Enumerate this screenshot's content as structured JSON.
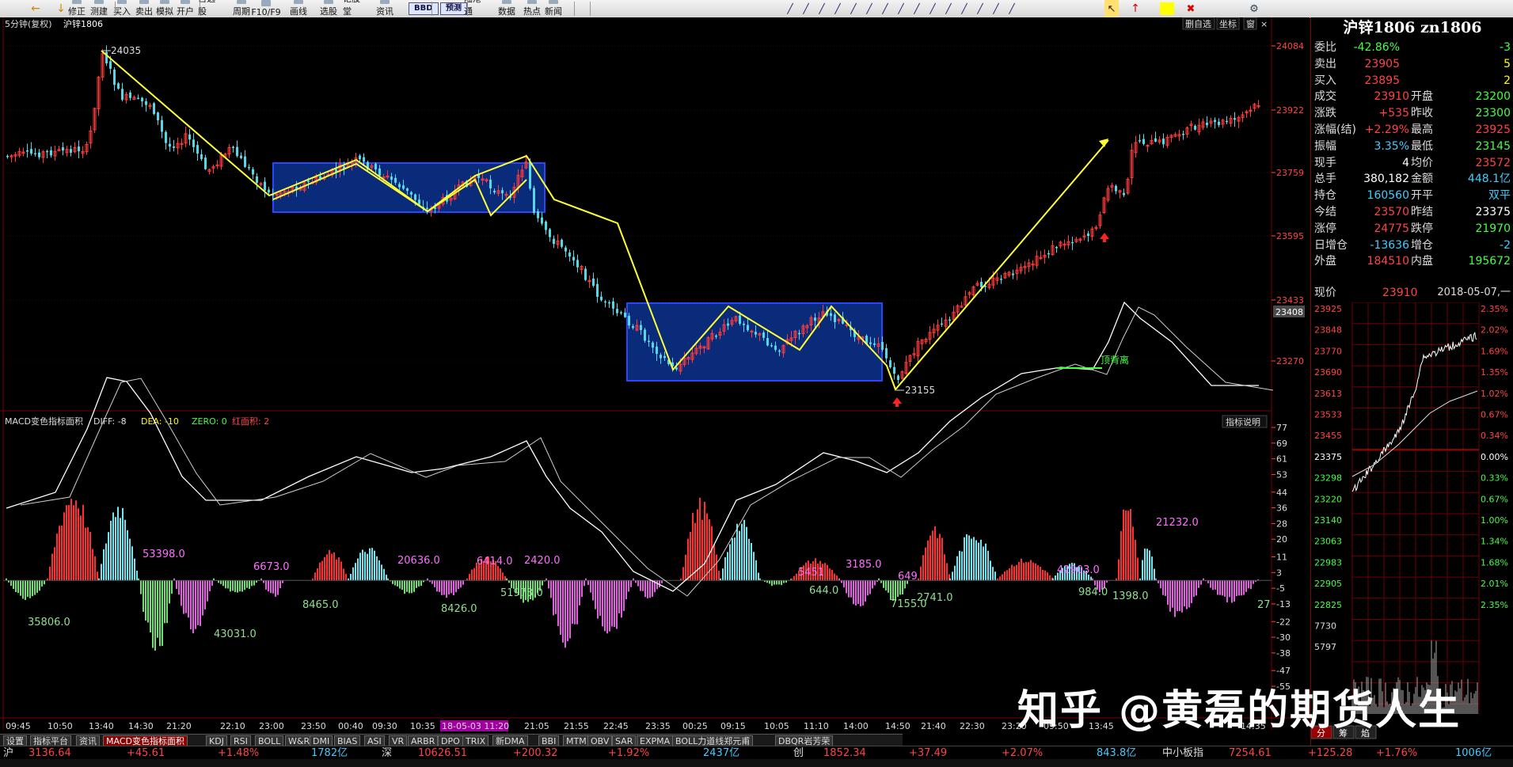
{
  "toolbar": {
    "items": [
      "修正",
      "测建",
      "买入",
      "卖出",
      "模拟",
      "开户",
      "自选股",
      "周期",
      "F10/F9",
      "画线",
      "选股",
      "论股堂",
      "资讯",
      "BBD",
      "预测",
      "陆港通",
      "数据",
      "热点",
      "新闻"
    ]
  },
  "chart": {
    "header": {
      "period": "5分钟(复权)",
      "symbol": "沪锌1806"
    },
    "top_right_buttons": [
      "删自选",
      "坐标",
      "窗"
    ],
    "peak_label": "24035",
    "low_label": "23155",
    "price_axis": [
      "24084",
      "23922",
      "23759",
      "23595",
      "23433",
      "23408",
      "23270"
    ],
    "price_marker": "23408",
    "colors": {
      "up": "#ff3b3b",
      "down": "#54d8e8",
      "line": "#ffff33",
      "box_fill": "#0a2a7a",
      "box_border": "#2848ff",
      "grid": "#7a0000",
      "axis_text": "#ff4444"
    }
  },
  "macd": {
    "title": "MACD变色指标面积",
    "diff_label": "DIFF: -8",
    "dea_label": "DEA: -10",
    "zero_label": "ZERO: 0",
    "red_label": "红面积: 2",
    "help_button": "指标说明",
    "axis": [
      "77",
      "69",
      "61",
      "53",
      "44",
      "36",
      "28",
      "20",
      "11",
      "3",
      "-5",
      "-13",
      "-22",
      "-30",
      "-38",
      "-47",
      "-55"
    ],
    "area_labels": [
      {
        "t": "35806.0",
        "c": "#8fe08f"
      },
      {
        "t": "53398.0",
        "c": "#ff70ff"
      },
      {
        "t": "43031.0",
        "c": "#8fe08f"
      },
      {
        "t": "6673.0",
        "c": "#ff70ff"
      },
      {
        "t": "8465.0",
        "c": "#8fe08f"
      },
      {
        "t": "20636.0",
        "c": "#ff70ff"
      },
      {
        "t": "8426.0",
        "c": "#8fe08f"
      },
      {
        "t": "6414.0",
        "c": "#ff70ff"
      },
      {
        "t": "2420.0",
        "c": "#ff70ff"
      },
      {
        "t": "51973.0",
        "c": "#8fe08f"
      },
      {
        "t": "5451",
        "c": "#ff70ff"
      },
      {
        "t": "644.0",
        "c": "#8fe08f"
      },
      {
        "t": "3185.0",
        "c": "#ff70ff"
      },
      {
        "t": "7155.0",
        "c": "#8fe08f"
      },
      {
        "t": "649",
        "c": "#ff70ff"
      },
      {
        "t": "2741.0",
        "c": "#8fe08f"
      },
      {
        "t": "42903.0",
        "c": "#ff70ff"
      },
      {
        "t": "984.0",
        "c": "#8fe08f"
      },
      {
        "t": "1398.0",
        "c": "#8fe08f"
      },
      {
        "t": "21232.0",
        "c": "#ff70ff"
      },
      {
        "t": "27",
        "c": "#8fe08f"
      }
    ],
    "divergence_label": "顶背离"
  },
  "time_axis": [
    "09:45",
    "10:50",
    "13:40",
    "14:30",
    "21:20",
    "22:10",
    "23:00",
    "23:50",
    "00:40",
    "09:30",
    "10:35",
    "18-05-03 11:20",
    "21:05",
    "21:55",
    "22:45",
    "23:35",
    "00:25",
    "09:15",
    "10:05",
    "11:10",
    "14:00",
    "14:50",
    "21:40",
    "22:30",
    "23:20",
    "09:50",
    "13:45",
    "14:35"
  ],
  "tabs": [
    "设置",
    "指标平台",
    "资讯",
    "MACD变色指标面积",
    "KDJ",
    "RSI",
    "BOLL",
    "W&R",
    "DMI",
    "BIAS",
    "ASI",
    "VR",
    "ARBR",
    "DPO",
    "TRIX",
    "新DMA",
    "BBI",
    "MTM",
    "OBV",
    "SAR",
    "EXPMA",
    "BOLL力道线郑元甫",
    "DBQR岩芳荣"
  ],
  "active_tab": "MACD变色指标面积",
  "quote": {
    "title": "沪锌1806 zn1806",
    "rows": [
      {
        "l": "委比",
        "v": "-42.86%",
        "vc": "#4f4",
        "r": "-3",
        "rc": "#4f4"
      },
      {
        "l": "卖出",
        "v": "23905",
        "vc": "#f44",
        "r": "5",
        "rc": "#ff0"
      },
      {
        "l": "买入",
        "v": "23895",
        "vc": "#f44",
        "r": "2",
        "rc": "#ff0"
      },
      {
        "l": "成交",
        "v": "23910",
        "vc": "#f44",
        "l2": "开盘",
        "r": "23200",
        "rc": "#4f4"
      },
      {
        "l": "涨跌",
        "v": "+535",
        "vc": "#f44",
        "l2": "昨收",
        "r": "23300",
        "rc": "#4f4"
      },
      {
        "l": "涨幅(结)",
        "v": "+2.29%",
        "vc": "#f44",
        "l2": "最高",
        "r": "23925",
        "rc": "#f44"
      },
      {
        "l": "振幅",
        "v": "3.35%",
        "vc": "#4cf",
        "l2": "最低",
        "r": "23145",
        "rc": "#4f4"
      },
      {
        "l": "现手",
        "v": "4",
        "vc": "#fff",
        "l2": "均价",
        "r": "23572",
        "rc": "#f44"
      },
      {
        "l": "总手",
        "v": "380,182",
        "vc": "#fff",
        "l2": "金额",
        "r": "448.1亿",
        "rc": "#4cf"
      },
      {
        "l": "持仓",
        "v": "160560",
        "vc": "#4cf",
        "l2": "开平",
        "r": "双平",
        "rc": "#4cf"
      },
      {
        "l": "今结",
        "v": "23570",
        "vc": "#f44",
        "l2": "昨结",
        "r": "23375",
        "rc": "#fff"
      },
      {
        "l": "涨停",
        "v": "24775",
        "vc": "#f44",
        "l2": "跌停",
        "r": "21970",
        "rc": "#4f4"
      },
      {
        "l": "日增仓",
        "v": "-13636",
        "vc": "#4cf",
        "l2": "增仓",
        "r": "-2",
        "rc": "#4cf"
      },
      {
        "l": "外盘",
        "v": "184510",
        "vc": "#f44",
        "l2": "内盘",
        "r": "195672",
        "rc": "#4f4"
      }
    ],
    "price_label": "现价",
    "price_value": "23910",
    "date_text": "2018-05-07,一"
  },
  "mini_chart": {
    "left_axis": [
      "23925",
      "23848",
      "23770",
      "23690",
      "23613",
      "23533",
      "23455",
      "23375",
      "23298",
      "23220",
      "23140",
      "23063",
      "22983",
      "22905",
      "22825",
      "7730",
      "5797"
    ],
    "right_axis": [
      "2.35%",
      "2.02%",
      "1.69%",
      "1.35%",
      "1.02%",
      "0.67%",
      "0.34%",
      "0.00%",
      "0.33%",
      "0.67%",
      "1.00%",
      "1.34%",
      "1.68%",
      "2.01%",
      "2.35%"
    ],
    "tabs": [
      "分",
      "筹",
      "焰"
    ]
  },
  "status": {
    "items": [
      {
        "t": "3136.64",
        "c": "#f44"
      },
      {
        "t": "+45.61",
        "c": "#f44"
      },
      {
        "t": "+1.48%",
        "c": "#f44"
      },
      {
        "t": "1782亿",
        "c": "#4cf"
      },
      {
        "t": "深",
        "c": "#ddd"
      },
      {
        "t": "10626.51",
        "c": "#f44"
      },
      {
        "t": "+200.32",
        "c": "#f44"
      },
      {
        "t": "+1.92%",
        "c": "#f44"
      },
      {
        "t": "2437亿",
        "c": "#4cf"
      },
      {
        "t": "创",
        "c": "#ddd"
      },
      {
        "t": "1852.34",
        "c": "#f44"
      },
      {
        "t": "+37.49",
        "c": "#f44"
      },
      {
        "t": "+2.07%",
        "c": "#f44"
      },
      {
        "t": "843.8亿",
        "c": "#4cf"
      },
      {
        "t": "中小板指",
        "c": "#ddd"
      },
      {
        "t": "7254.61",
        "c": "#f44"
      },
      {
        "t": "+125.28",
        "c": "#f44"
      },
      {
        "t": "+1.76%",
        "c": "#f44"
      },
      {
        "t": "1006亿",
        "c": "#4cf"
      }
    ]
  },
  "watermark": "知乎 @黄磊的期货人生"
}
